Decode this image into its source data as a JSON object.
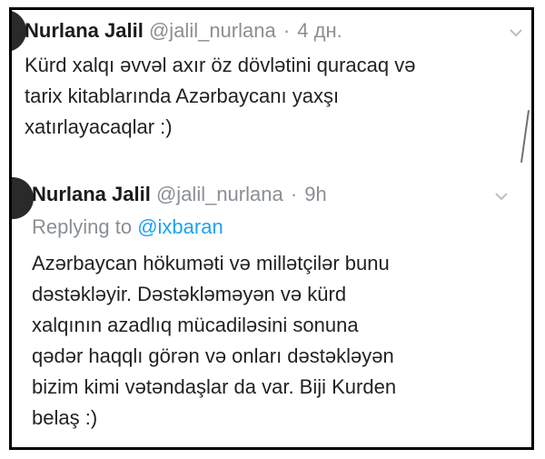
{
  "tweets": [
    {
      "name": "Nurlana Jalil",
      "handle": "@jalil_nurlana",
      "time": "4 дн.",
      "lines": [
        "Kürd xalqı əvvəl axır öz dövlətini quracaq və",
        "tarix kitablarında Azərbaycanı yaxşı",
        "xatırlayacaqlar :)"
      ]
    },
    {
      "name": "Nurlana Jalil",
      "handle": "@jalil_nurlana",
      "time": "9h",
      "replying_label": "Replying to",
      "replying_handle": "@ixbaran",
      "lines": [
        "Azərbaycan hökuməti və millətçilər bunu",
        "dəstəkləyir. Dəstəkləməyən və kürd",
        "xalqının azadlıq mücadiləsini sonuna",
        "qədər haqqlı görən və onları dəstəkləyən",
        "bizim kimi vətəndaşlar da var. Biji Kurden",
        "belaş :)"
      ]
    }
  ],
  "separator": "·",
  "icons": {
    "avatar": "avatar-circle",
    "menu": "chevron-down-icon"
  },
  "colors": {
    "name": "#1b1b1b",
    "meta": "#8a8f94",
    "link": "#1da1f2",
    "text": "#222222"
  }
}
